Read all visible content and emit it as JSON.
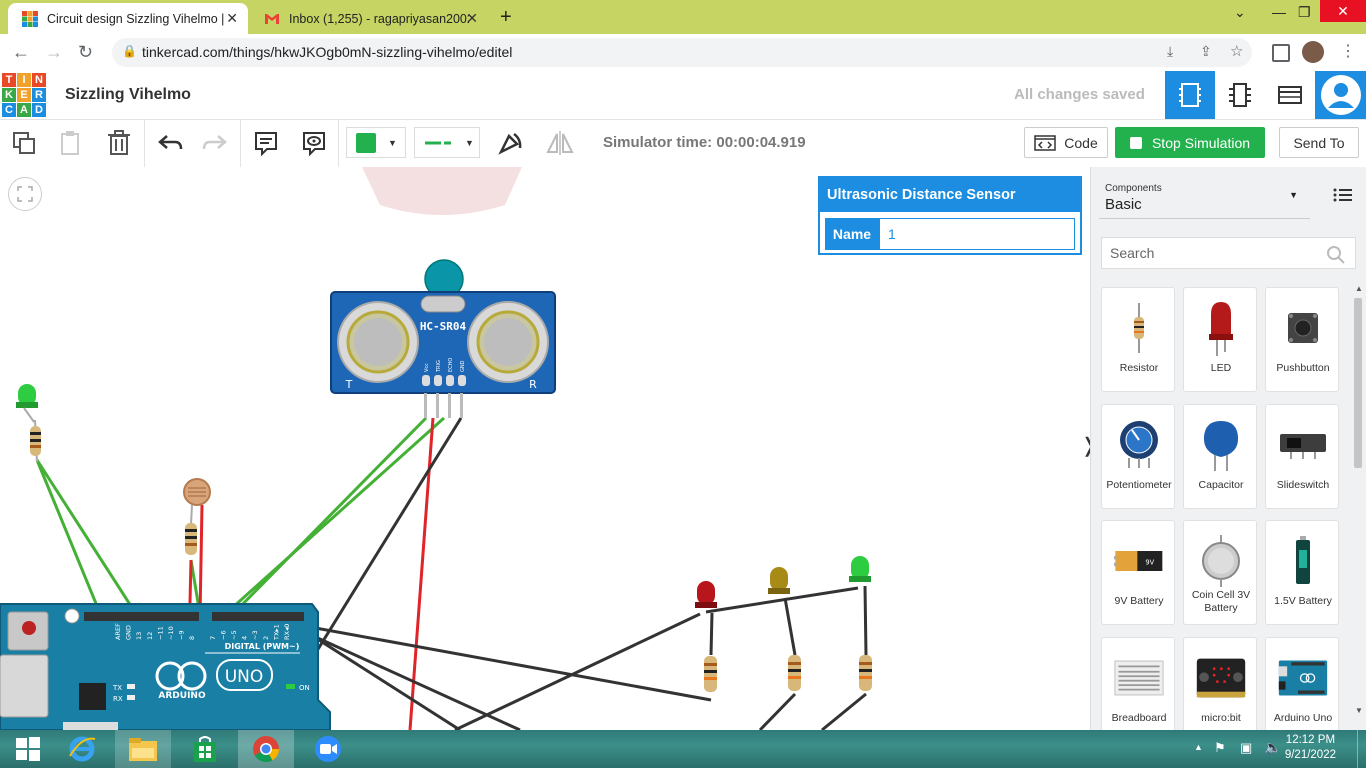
{
  "browser": {
    "tabs": [
      {
        "title": "Circuit design Sizzling Vihelmo | T",
        "active": true
      },
      {
        "title": "Inbox (1,255) - ragapriyasan2002",
        "active": false
      }
    ],
    "url": "tinkercad.com/things/hkwJKOgb0mN-sizzling-vihelmo/editel"
  },
  "header": {
    "logo_letters": [
      "T",
      "I",
      "N",
      "K",
      "E",
      "R",
      "C",
      "A",
      "D"
    ],
    "design_title": "Sizzling Vihelmo",
    "save_status": "All changes saved"
  },
  "toolbar": {
    "simulator_time": "Simulator time: 00:00:04.919",
    "code_label": "Code",
    "stop_label": "Stop Simulation",
    "send_label": "Send To",
    "color_swatch": "#22b14c"
  },
  "inspector": {
    "title": "Ultrasonic Distance Sensor",
    "name_label": "Name",
    "name_value": "1"
  },
  "canvas": {
    "sensor_label": "HC-SR04",
    "sensor_pins": [
      "Vcc",
      "TRIG",
      "ECHO",
      "GND"
    ],
    "sensor_t": "T",
    "sensor_r": "R",
    "board_label": "ARDUINO",
    "board_model": "UNO",
    "board_digital": "DIGITAL (PWM~)",
    "board_pins": [
      "AREF",
      "GND",
      "13",
      "12",
      "~11",
      "~10",
      "~9",
      "8",
      "7",
      "~6",
      "~5",
      "4",
      "~3",
      "2",
      "TX▸1",
      "RX◂0"
    ],
    "tx": "TX",
    "rx": "RX",
    "on": "ON"
  },
  "panel": {
    "components_label": "Components",
    "components_value": "Basic",
    "search_placeholder": "Search",
    "items": [
      {
        "label": "Resistor"
      },
      {
        "label": "LED"
      },
      {
        "label": "Pushbutton"
      },
      {
        "label": "Potentiometer"
      },
      {
        "label": "Capacitor"
      },
      {
        "label": "Slideswitch"
      },
      {
        "label": "9V Battery"
      },
      {
        "label": "Coin Cell 3V Battery"
      },
      {
        "label": "1.5V Battery"
      },
      {
        "label": "Breadboard"
      },
      {
        "label": "micro:bit"
      },
      {
        "label": "Arduino Uno"
      }
    ]
  },
  "taskbar": {
    "time": "12:12 PM",
    "date": "9/21/2022"
  }
}
